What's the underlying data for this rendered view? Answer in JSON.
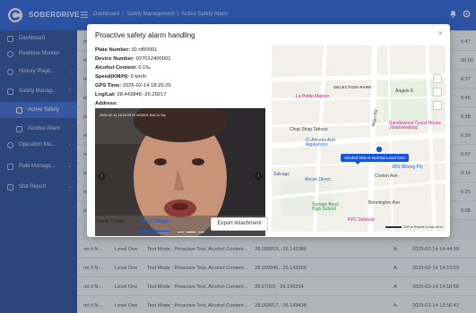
{
  "app": {
    "brand": "SOBERDRIVE"
  },
  "breadcrumb": [
    "Dashboard",
    "Safety Management",
    "Active Safety Alarm"
  ],
  "sidebar": {
    "items": [
      {
        "label": "Dashboard"
      },
      {
        "label": "Realtime Monitor"
      },
      {
        "label": "History Playb..."
      },
      {
        "label": "Safety Manag..."
      },
      {
        "label": "Active Safety"
      },
      {
        "label": "Alcohol Alarm"
      },
      {
        "label": "Operation Me..."
      },
      {
        "label": "Rule Manage..."
      },
      {
        "label": "Stat Report"
      }
    ]
  },
  "table": {
    "right_times": [
      "6:47",
      "00:00",
      "6:27",
      "6:45",
      "0:38",
      "6:39",
      "6:57",
      "0:14",
      "6:25",
      "0:08"
    ],
    "rows": [
      {
        "id": "ret ti N...",
        "level": "Level One",
        "mode": "Test Mode : Proactive Test, Alcohol Content...",
        "lnglat": "28.268919, -26.142386",
        "flag": "A",
        "time": "2025-02-14 14:44:39"
      },
      {
        "id": "ret ti N...",
        "level": "Level One",
        "mode": "Test Mode : Proactive Test, Alcohol Content...",
        "lnglat": "28.269946, -26.143366",
        "flag": "A",
        "time": "2025-02-14 14:19:59"
      },
      {
        "id": "ret ti N...",
        "level": "Level One",
        "mode": "Test Mode : Proactive Test, Alcohol Content...",
        "lnglat": "28.27002, -26.146294",
        "flag": "A",
        "time": "2025-02-14 14:18:56"
      },
      {
        "id": "ret ti N...",
        "level": "Level One",
        "mode": "Test Mode : Proactive Test, Alcohol Content...",
        "lnglat": "28.269917, -26.143438",
        "flag": "A",
        "time": "2025-02-14 13:56:42"
      }
    ]
  },
  "modal": {
    "title": "Proactive safety alarm handling",
    "close": "×",
    "plate_label": "Plate Number:",
    "plate_value": "ID.nf00001",
    "device_label": "Device Number:",
    "device_value": "027012400001",
    "alcohol_label": "Alcohol Content:",
    "alcohol_value": "0.1‰",
    "speed_label": "Speed(KM/H):",
    "speed_value": "0 km/h",
    "gps_label": "GPS Time:",
    "gps_value": "2025-02-14 18:25:25",
    "lnglat_label": "Lng/Lat:",
    "lnglat_value": "28.443848,-26.29217",
    "address_label": "Address:",
    "address_value": "",
    "video_timestamp": "2025-02-14 18:25:25 ID.nf00001 BAC:0.1‰",
    "tabs": [
      "Alarm Video",
      "Alarm Image"
    ],
    "active_tab": "Alarm Image",
    "export_label": "Export Attachment"
  },
  "map": {
    "labels": {
      "selection_park": "SELECTION PARK",
      "angelo": "Angelo K",
      "la_petite": "La Petite Maison",
      "sandalwood": "Sandalwood Guest House Johannesburg",
      "chop_shop": "Chop Shop Tattoos",
      "ic_aircons": "IC Aircons And Appliances",
      "alarm_tag": "Alcohol Test Is Normal Level One",
      "jrs_biltong": "JRS Biltong Pty",
      "salvage": "Salvage",
      "aircon_direct": "Aircon Direct",
      "coston": "Coston Ave",
      "springs_boys": "Springs Boys' High School",
      "bennington": "Bennington Ave",
      "kfc": "KFC Selcourt",
      "nigel_rd": "Nigel Rd",
      "scale": "200 m",
      "report": "Report a map error"
    }
  },
  "colors": {
    "primary": "#1a55d8",
    "sidebar": "#1b3f8f",
    "sidebar_active": "#2d5fd0"
  }
}
